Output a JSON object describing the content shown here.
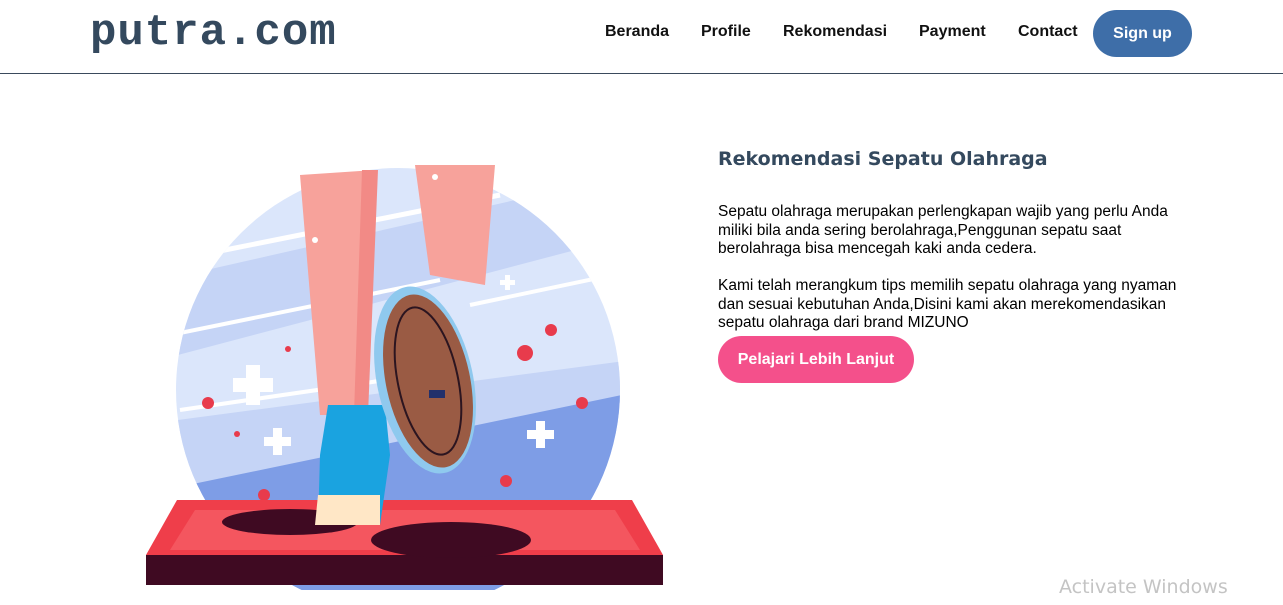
{
  "header": {
    "logo": "putra.com",
    "nav": [
      {
        "label": "Beranda"
      },
      {
        "label": "Profile"
      },
      {
        "label": "Rekomendasi"
      },
      {
        "label": "Payment"
      },
      {
        "label": "Contact"
      }
    ],
    "signup_label": "Sign up"
  },
  "hero": {
    "title": "Rekomendasi Sepatu Olahraga",
    "paragraph_1": "Sepatu olahraga merupakan perlengkapan wajib yang perlu Anda miliki bila anda sering berolahraga,Penggunan sepatu saat berolahraga bisa mencegah kaki anda cedera.",
    "paragraph_2": "Kami telah merangkum tips memilih sepatu olahraga yang nyaman dan sesuai kebutuhan Anda,Disini kami akan merekomendasikan sepatu olahraga dari brand MIZUNO",
    "cta_label": "Pelajari Lebih Lanjut"
  },
  "os": {
    "watermark": "Activate Windows"
  },
  "colors": {
    "accent": "#3e6ea8",
    "cta": "#f4508b",
    "heading": "#34495e"
  }
}
